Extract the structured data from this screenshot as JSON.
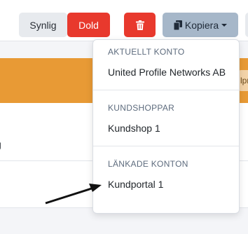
{
  "toolbar": {
    "synlig_label": "Synlig",
    "dold_label": "Dold",
    "delete_icon": "trash-icon",
    "copy_icon": "copy-icon",
    "kopiera_label": "Kopiera",
    "caret_icon": "caret-down-icon"
  },
  "background": {
    "cut_text": "g",
    "badge_text": "lpr"
  },
  "menu": {
    "sections": [
      {
        "header": "AKTUELLT KONTO",
        "item": "United Profile Networks AB"
      },
      {
        "header": "KUNDSHOPPAR",
        "item": "Kundshop 1"
      },
      {
        "header": "LÄNKADE KONTON",
        "item": "Kundportal 1"
      }
    ]
  },
  "colors": {
    "danger": "#e8392d",
    "secondary": "#a6b7c9",
    "orange": "#e89a35"
  }
}
